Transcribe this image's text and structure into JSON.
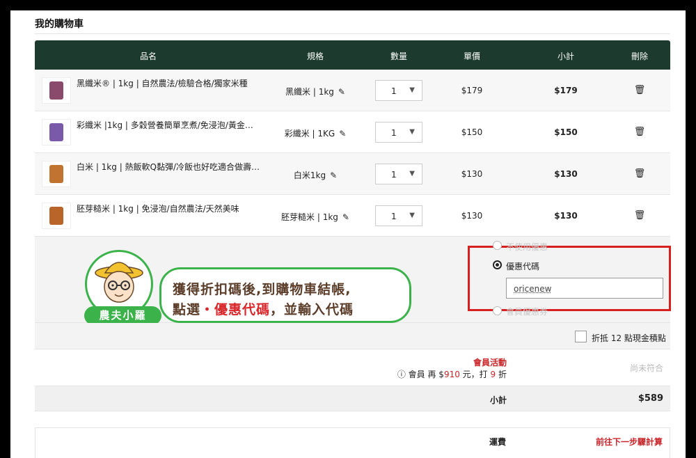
{
  "section_title": "我的購物車",
  "table": {
    "headers": [
      "品名",
      "規格",
      "數量",
      "單價",
      "小計",
      "刪除"
    ],
    "rows": [
      {
        "name": "黑纖米® | 1kg | 自然農法/檢驗合格/獨家米種",
        "spec": "黑纖米 | 1kg",
        "qty": "1",
        "price": "$179",
        "subtotal": "$179",
        "thumb_color": "#8a4a6b"
      },
      {
        "name": "彩纖米 |1kg | 多穀營養簡單烹煮/免浸泡/黃金…",
        "spec": "彩纖米 | 1KG",
        "qty": "1",
        "price": "$150",
        "subtotal": "$150",
        "thumb_color": "#7a5aa8"
      },
      {
        "name": "白米 | 1kg | 熱飯軟Q黏彈/冷飯也好吃適合做壽…",
        "spec": "白米1kg",
        "qty": "1",
        "price": "$130",
        "subtotal": "$130",
        "thumb_color": "#c0742f"
      },
      {
        "name": "胚芽糙米 | 1kg | 免浸泡/自然農法/天然美味",
        "spec": "胚芽糙米 | 1kg",
        "qty": "1",
        "price": "$130",
        "subtotal": "$130",
        "thumb_color": "#b9652a"
      }
    ]
  },
  "coupon": {
    "option_none": "不使用優惠",
    "option_code": "優惠代碼",
    "code_value": "oricenew",
    "option_member": "會員優惠券"
  },
  "callout": {
    "line1": "獲得折扣碼後,到購物車結帳,",
    "line2_prefix": "點選",
    "line2_highlight": "・優惠代碼",
    "line2_suffix": "，並輸入代碼",
    "character_name": "農夫小羅"
  },
  "points": {
    "label": "折抵 12 點現金積點"
  },
  "promotion": {
    "title": "會員活動",
    "msg_prefix": "會員 再 $",
    "msg_amount": "910",
    "msg_mid": "元，打",
    "msg_discount": "9",
    "msg_suffix": "折",
    "status": "尚未符合"
  },
  "subtotal": {
    "label": "小計",
    "value": "$589"
  },
  "shipping": {
    "label": "運費",
    "value": "前往下一步驟計算"
  },
  "colors": {
    "header_bg": "#1d3a2f",
    "highlight_red": "#d81f1f",
    "callout_green": "#3bb34a"
  }
}
